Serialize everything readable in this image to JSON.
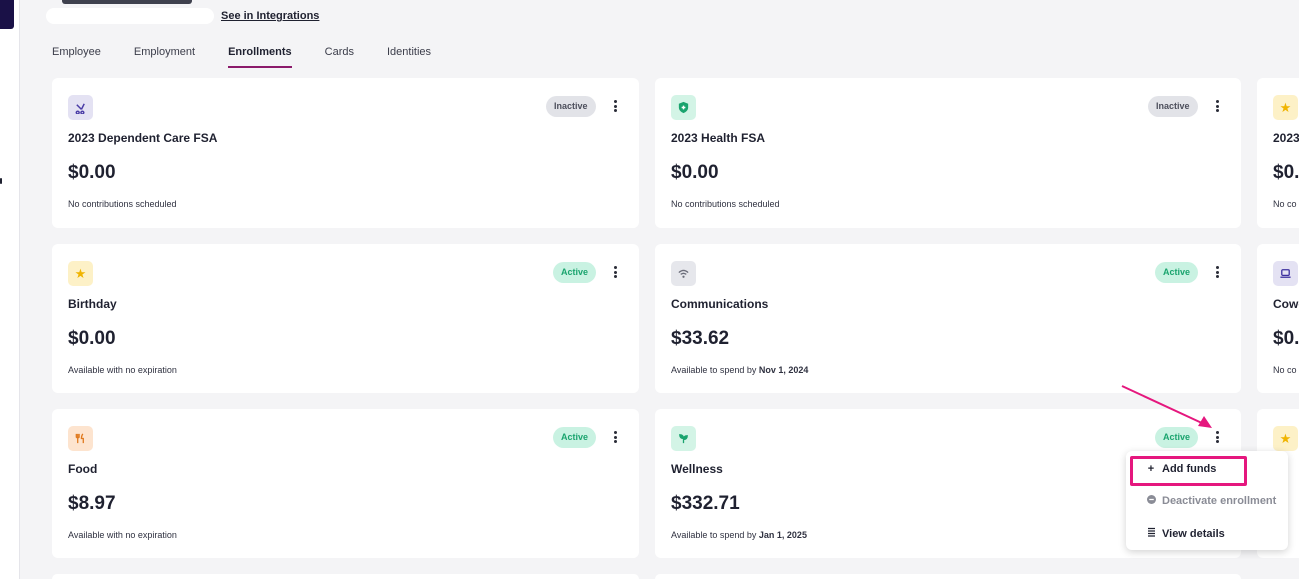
{
  "header": {
    "integrations_link": "See in Integrations"
  },
  "tabs": [
    {
      "label": "Employee",
      "active": false
    },
    {
      "label": "Employment",
      "active": false
    },
    {
      "label": "Enrollments",
      "active": true
    },
    {
      "label": "Cards",
      "active": false
    },
    {
      "label": "Identities",
      "active": false
    }
  ],
  "cards": {
    "dependent_care": {
      "title": "2023 Dependent Care FSA",
      "amount": "$0.00",
      "note": "No contributions scheduled",
      "status": "Inactive",
      "icon": "stroller-icon"
    },
    "health_fsa": {
      "title": "2023 Health FSA",
      "amount": "$0.00",
      "note": "No contributions scheduled",
      "status": "Inactive",
      "icon": "health-shield-icon"
    },
    "third_col_top": {
      "title": "2023",
      "amount": "$0.",
      "note": "No co",
      "icon": "star-icon"
    },
    "birthday": {
      "title": "Birthday",
      "amount": "$0.00",
      "note": "Available with no expiration",
      "status": "Active",
      "icon": "star-icon"
    },
    "communications": {
      "title": "Communications",
      "amount": "$33.62",
      "note_prefix": "Available to spend by ",
      "note_date": "Nov 1, 2024",
      "status": "Active",
      "icon": "wifi-icon"
    },
    "third_col_mid": {
      "title": "Cowo",
      "amount": "$0.",
      "note": "No co",
      "icon": "laptop-icon"
    },
    "food": {
      "title": "Food",
      "amount": "$8.97",
      "note": "Available with no expiration",
      "status": "Active",
      "icon": "fork-knife-icon"
    },
    "wellness": {
      "title": "Wellness",
      "amount": "$332.71",
      "note_prefix": "Available to spend by ",
      "note_date": "Jan 1, 2025",
      "status": "Active",
      "icon": "leaf-icon"
    },
    "third_col_bot": {
      "icon": "star-icon"
    }
  },
  "menu": {
    "add_funds": "Add funds",
    "deactivate": "Deactivate enrollment",
    "view_details": "View details"
  },
  "colors": {
    "accent": "#8b1a6b",
    "active_badge_bg": "#c9f2e2",
    "active_badge_text": "#1aa46e",
    "inactive_badge_bg": "#e2e3e8",
    "annotation": "#e5177e"
  }
}
